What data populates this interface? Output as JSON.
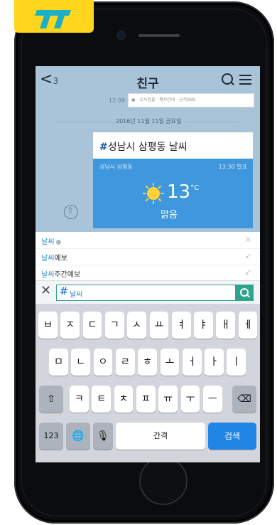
{
  "header": {
    "back_glyph": "<",
    "back_count": "3",
    "title": "친구"
  },
  "previous_message": {
    "time": "12:09",
    "text": "▣ · 오사업물 · 행사안내 · 공식SNS"
  },
  "date_divider": "2016년 11월 11일 금요일",
  "weather_card": {
    "hash": "#",
    "title": "성남시 삼평동 날씨",
    "location": "성남시 삼평동",
    "time": "13:30 발표",
    "temperature": "13",
    "unit": "°C",
    "condition": "맑음"
  },
  "suggestions": [
    {
      "highlight": "날씨",
      "rest": "",
      "action": "×"
    },
    {
      "highlight": "날씨",
      "rest": "예보",
      "action": "↙"
    },
    {
      "highlight": "날씨",
      "rest": "주간예보",
      "action": "↙"
    }
  ],
  "input": {
    "hash": "#",
    "value": "날씨",
    "clear": "✕"
  },
  "keyboard": {
    "row1": [
      "ㅂ",
      "ㅈ",
      "ㄷ",
      "ㄱ",
      "ㅅ",
      "ㅛ",
      "ㅕ",
      "ㅑ",
      "ㅐ",
      "ㅔ"
    ],
    "row2": [
      "ㅁ",
      "ㄴ",
      "ㅇ",
      "ㄹ",
      "ㅎ",
      "ㅗ",
      "ㅓ",
      "ㅏ",
      "ㅣ"
    ],
    "row3": [
      "ㅋ",
      "ㅌ",
      "ㅊ",
      "ㅍ",
      "ㅠ",
      "ㅜ",
      "ㅡ"
    ],
    "shift": "⇧",
    "backspace": "⌫",
    "numbers": "123",
    "globe": "🌐",
    "mic": "🎙",
    "space": "간격",
    "search": "검색"
  }
}
